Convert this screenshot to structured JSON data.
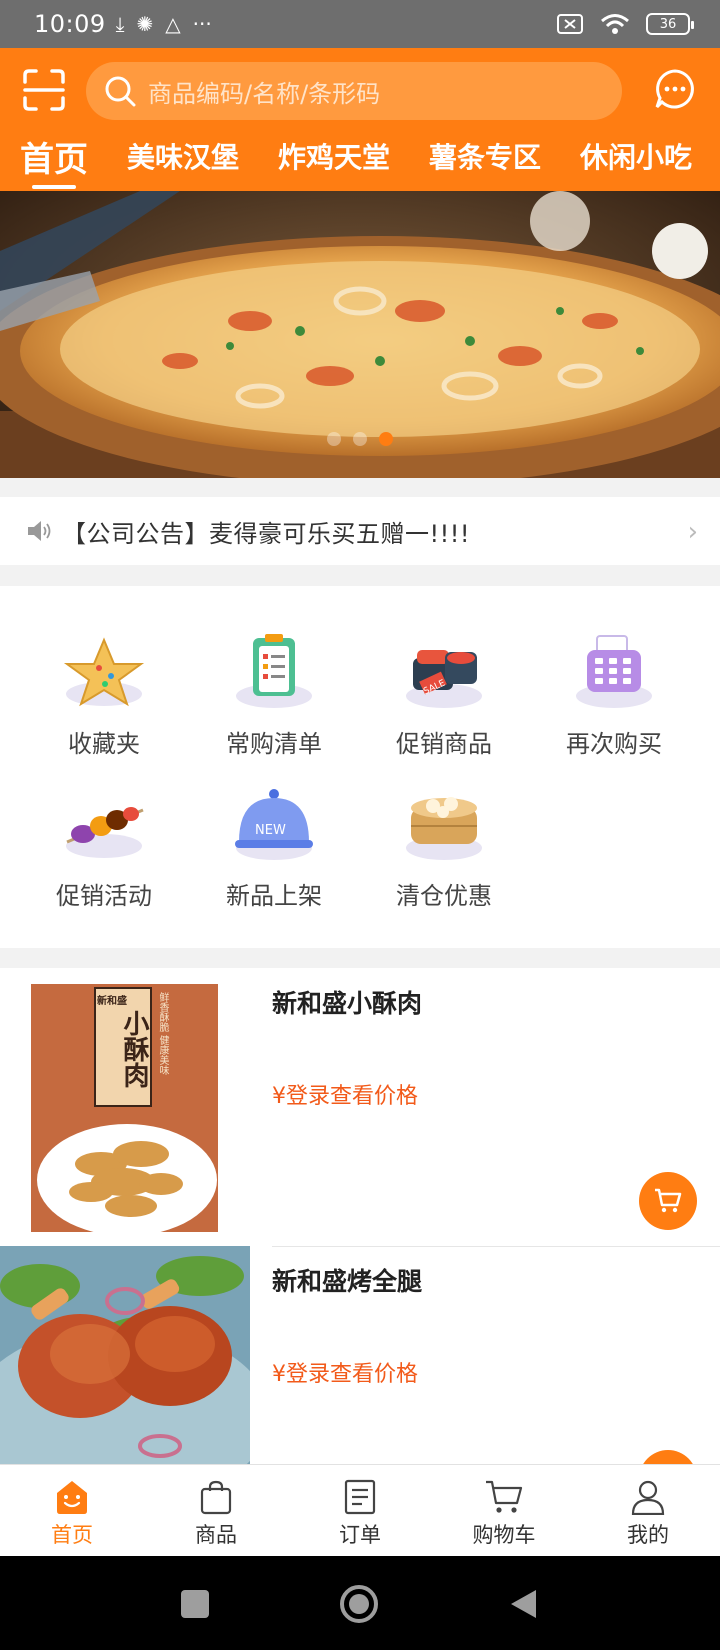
{
  "status_bar": {
    "time": "10:09",
    "battery": "36"
  },
  "header": {
    "search_placeholder": "商品编码/名称/条形码"
  },
  "tabs": [
    {
      "label": "首页",
      "active": true
    },
    {
      "label": "美味汉堡"
    },
    {
      "label": "炸鸡天堂"
    },
    {
      "label": "薯条专区"
    },
    {
      "label": "休闲小吃"
    }
  ],
  "banner": {
    "slide_count": 3,
    "active_index": 2
  },
  "notice": {
    "text": "【公司公告】麦得豪可乐买五赠一!!!!"
  },
  "quick_menu": [
    {
      "label": "收藏夹",
      "icon": "star-cookie-icon"
    },
    {
      "label": "常购清单",
      "icon": "clipboard-icon"
    },
    {
      "label": "促销商品",
      "icon": "sale-sushi-icon"
    },
    {
      "label": "再次购买",
      "icon": "register-icon"
    },
    {
      "label": "促销活动",
      "icon": "skewer-icon"
    },
    {
      "label": "新品上架",
      "icon": "new-cloche-icon"
    },
    {
      "label": "清仓优惠",
      "icon": "dim-sum-steamer-icon"
    }
  ],
  "products": [
    {
      "name": "新和盛小酥肉",
      "price": "¥登录查看价格",
      "thumb_text_main": "小酥肉",
      "thumb_text_brand": "新和盛",
      "thumb_text_side": "鲜香酥脆 健康美味"
    },
    {
      "name": "新和盛烤全腿",
      "price": "¥登录查看价格"
    }
  ],
  "bottom_nav": [
    {
      "label": "首页",
      "active": true
    },
    {
      "label": "商品"
    },
    {
      "label": "订单"
    },
    {
      "label": "购物车"
    },
    {
      "label": "我的"
    }
  ],
  "colors": {
    "accent": "#ff7d12",
    "price": "#f25a1a"
  }
}
